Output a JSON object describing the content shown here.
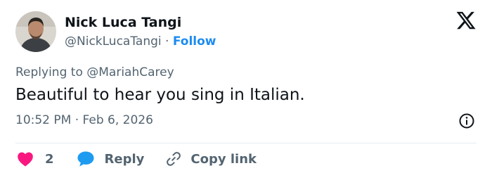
{
  "user": {
    "display_name": "Nick Luca Tangi",
    "handle": "@NickLucaTangi",
    "separator": "·",
    "follow_label": "Follow"
  },
  "tweet": {
    "replying_prefix": "Replying to ",
    "replying_to": "@MariahCarey",
    "text": "Beautiful to hear you sing in Italian.",
    "time": "10:52 PM",
    "date_separator": "·",
    "date": "Feb 6, 2026"
  },
  "actions": {
    "like_count": "2",
    "reply_label": "Reply",
    "copy_link_label": "Copy link"
  },
  "icons": {
    "brand": "x-logo-icon",
    "info": "info-icon",
    "like": "heart-icon",
    "reply": "speech-bubble-icon",
    "copy": "link-icon"
  },
  "colors": {
    "follow": "#1d8cf0",
    "heart": "#f91880",
    "reply_bubble": "#1d9bf0",
    "muted": "#536471",
    "text": "#0f1419"
  }
}
